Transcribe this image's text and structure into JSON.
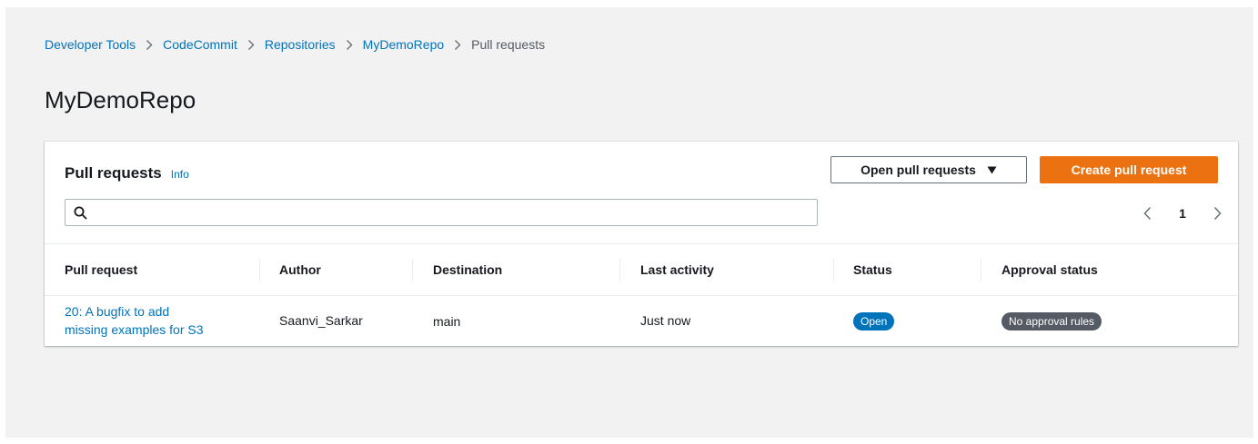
{
  "breadcrumb": {
    "items": [
      "Developer Tools",
      "CodeCommit",
      "Repositories",
      "MyDemoRepo"
    ],
    "current": "Pull requests"
  },
  "page": {
    "title": "MyDemoRepo"
  },
  "panel": {
    "title": "Pull requests",
    "info_label": "Info",
    "filter_value": "Open pull requests",
    "create_label": "Create pull request",
    "search_placeholder": "",
    "page_number": "1"
  },
  "table": {
    "headers": [
      "Pull request",
      "Author",
      "Destination",
      "Last activity",
      "Status",
      "Approval status"
    ],
    "rows": [
      {
        "pr_line1": "20: A bugfix to add",
        "pr_line2": "missing examples for S3",
        "author": "Saanvi_Sarkar",
        "destination": "main",
        "last_activity": "Just now",
        "status": "Open",
        "approval": "No approval rules"
      }
    ]
  },
  "icons": {
    "breadcrumb_separator": "chevron-right-icon",
    "filter": "caret-down-icon",
    "search": "search-icon",
    "pager_prev": "chevron-left-icon",
    "pager_next": "chevron-right-icon"
  },
  "colors": {
    "link": "#0073bb",
    "primary_button": "#ec7211",
    "status_open": "#0073bb",
    "approval_badge": "#545b64",
    "page_background": "#f2f2f2"
  }
}
